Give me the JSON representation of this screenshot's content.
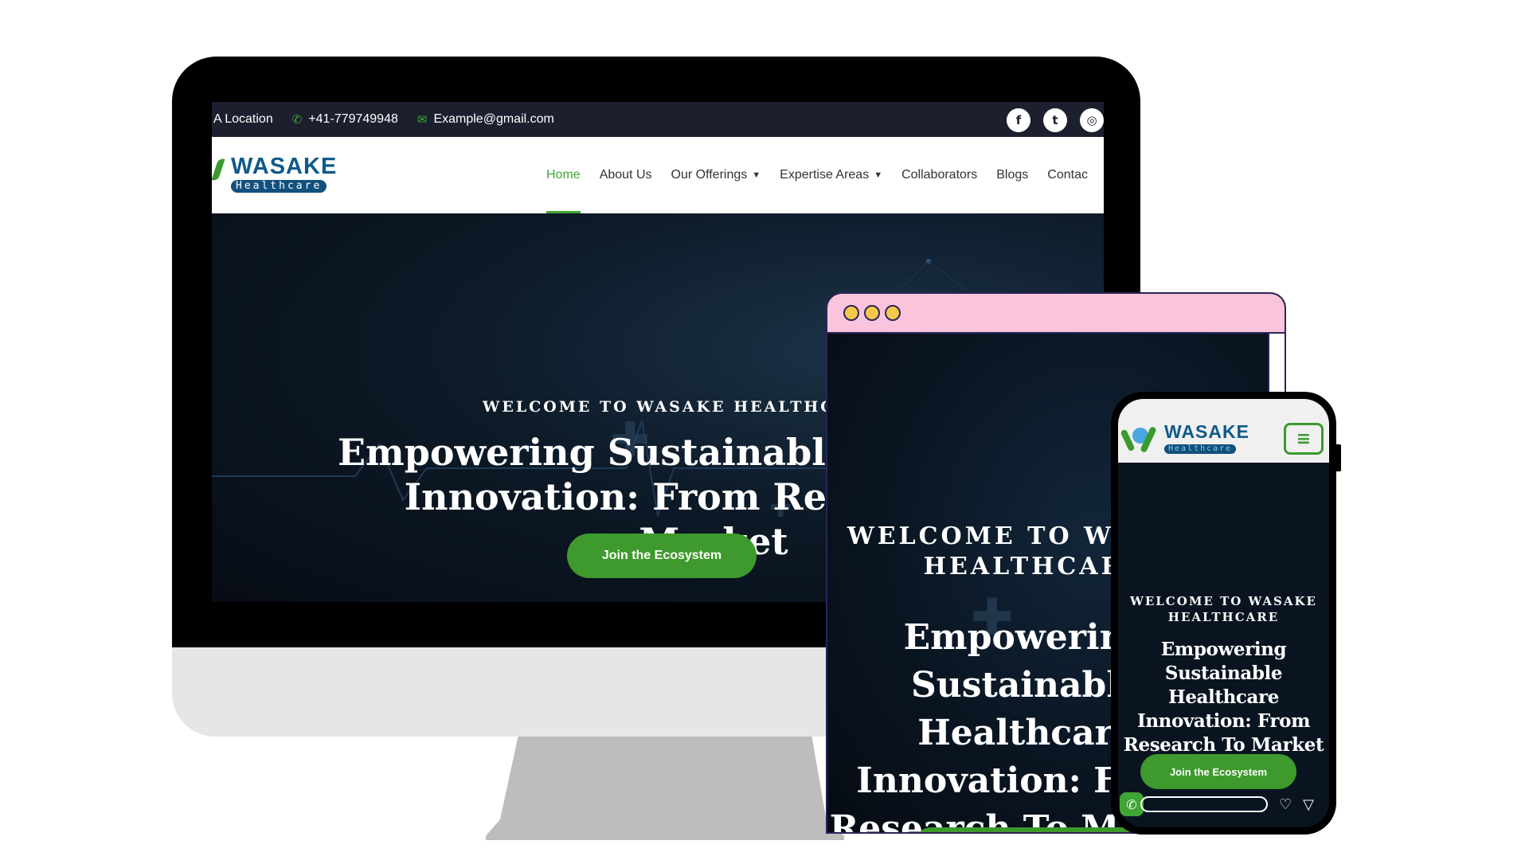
{
  "desktop": {
    "topbar": {
      "location": "A Location",
      "phone": "+41-779749948",
      "email": "Example@gmail.com",
      "socials": [
        "f",
        "t",
        "ig"
      ]
    },
    "logo": {
      "name": "WASAKE",
      "sub": "Healthcare"
    },
    "nav": {
      "items": [
        "Home",
        "About Us",
        "Our Offerings",
        "Expertise Areas",
        "Collaborators",
        "Blogs",
        "Contac"
      ],
      "active": "Home"
    },
    "hero": {
      "welcome": "WELCOME TO WASAKE HEALTHCARE",
      "title_line1": "Empowering Sustainable Healthcare",
      "title_line2": "Innovation: From Research To Market",
      "button": "Join the Ecosystem"
    }
  },
  "tablet": {
    "welcome": "WELCOME TO WASAKE HEALTHCARE",
    "title": "Empowering Sustainable Healthcare Innovation: From Research To Market"
  },
  "phone": {
    "logo": {
      "name": "WASAKE",
      "sub": "Healthcare"
    },
    "welcome": "WELCOME TO WASAKE HEALTHCARE",
    "title": "Empowering Sustainable Healthcare Innovation: From Research To Market",
    "button": "Join the Ecosystem"
  },
  "colors": {
    "accent_green": "#3e9a2c",
    "brand_blue": "#0e5a8a",
    "topbar_bg": "#1c1f2e",
    "tablet_header": "#f9c4dc"
  }
}
